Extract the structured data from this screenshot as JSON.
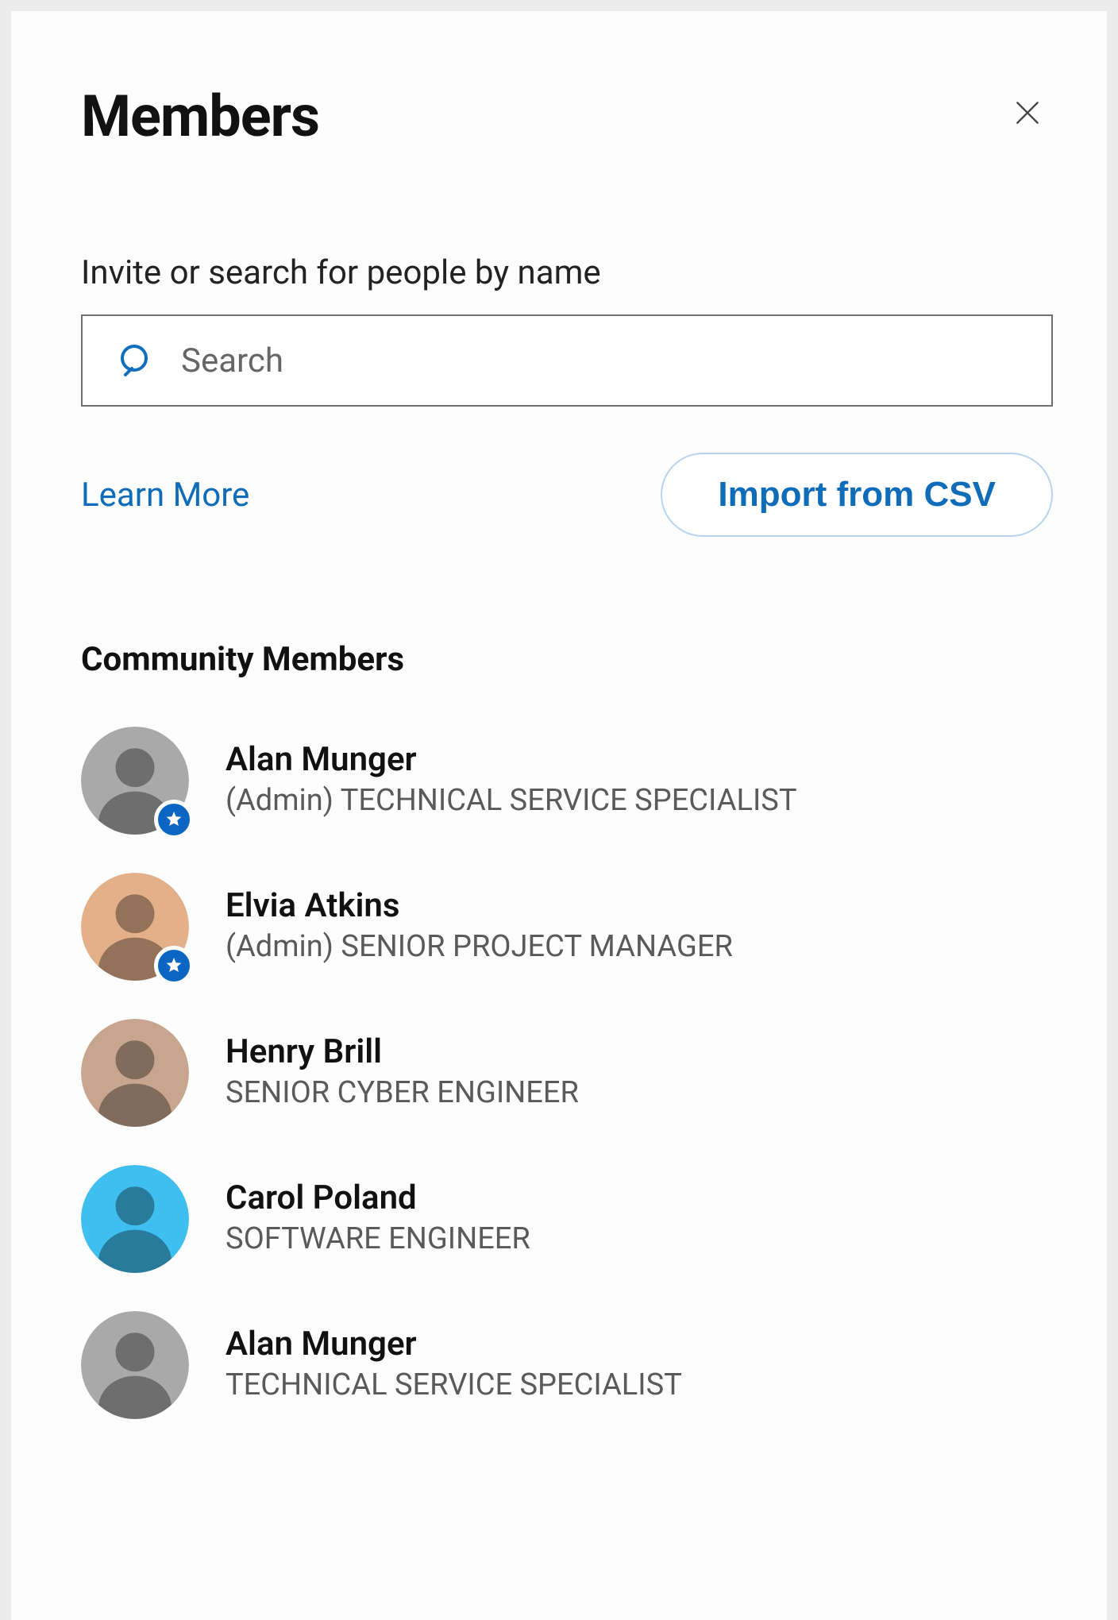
{
  "header": {
    "title": "Members"
  },
  "search": {
    "hint": "Invite or search for people by name",
    "placeholder": "Search"
  },
  "actions": {
    "learn_more": "Learn More",
    "import_csv": "Import from CSV"
  },
  "section": {
    "heading": "Community Members"
  },
  "members": [
    {
      "name": "Alan Munger",
      "role_label": "(Admin) TECHNICAL SERVICE SPECIALIST",
      "is_admin": true,
      "avatar_bg": "#a9a9a9"
    },
    {
      "name": "Elvia Atkins",
      "role_label": "(Admin) SENIOR PROJECT MANAGER",
      "is_admin": true,
      "avatar_bg": "#e3b08a"
    },
    {
      "name": "Henry Brill",
      "role_label": "SENIOR CYBER ENGINEER",
      "is_admin": false,
      "avatar_bg": "#c7a58e"
    },
    {
      "name": "Carol Poland",
      "role_label": "SOFTWARE ENGINEER",
      "is_admin": false,
      "avatar_bg": "#3fbef0"
    },
    {
      "name": "Alan Munger",
      "role_label": "TECHNICAL SERVICE SPECIALIST",
      "is_admin": false,
      "avatar_bg": "#a9a9a9"
    }
  ]
}
